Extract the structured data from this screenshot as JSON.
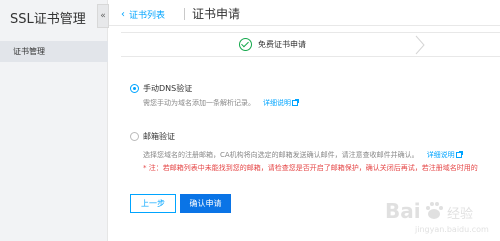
{
  "sidebar": {
    "title": "SSL证书管理",
    "collapse_glyph": "«",
    "items": [
      {
        "label": "证书管理"
      }
    ]
  },
  "header": {
    "back_label": "证书列表",
    "title": "证书申请"
  },
  "steps": {
    "current_label": "免费证书申请"
  },
  "options": [
    {
      "title": "手动DNS验证",
      "selected": true,
      "desc": "需您手动为域名添加一条解析记录。",
      "link": "详细说明"
    },
    {
      "title": "邮箱验证",
      "selected": false,
      "desc": "选择您域名的注册邮箱，CA机构将向选定的邮箱发送确认邮件，请注意查收邮件并确认。",
      "link": "详细说明",
      "warning": "* 注：若邮箱列表中未能找到您的邮箱，请检查您是否开启了邮箱保护，确认关闭后再试，若注册域名时用的"
    }
  ],
  "buttons": {
    "prev": "上一步",
    "confirm": "确认申请"
  },
  "watermark": {
    "text": "Baidu",
    "sub": "经验",
    "url": "jingyan.baidu.com"
  }
}
